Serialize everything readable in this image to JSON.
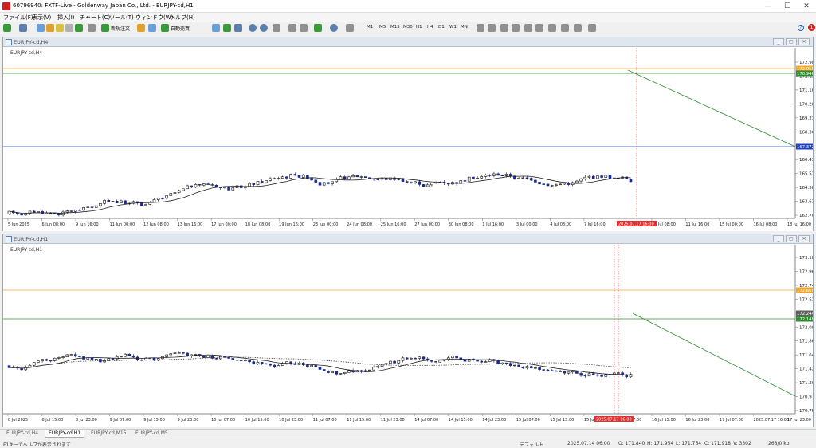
{
  "window": {
    "title": "60796940: FXTF-Live - Goldenway Japan Co., Ltd. - EURJPY-cd,H1",
    "minimize": "—",
    "maximize": "☐",
    "close": "✕"
  },
  "menu": [
    "ファイル(F)",
    "表示(V)",
    "挿入(I)",
    "チャート(C)",
    "ツール(T)",
    "ウィンドウ(W)",
    "ヘルプ(H)"
  ],
  "toolbar": {
    "new_order": "新規注文",
    "auto_trade": "自動売買",
    "timeframes": [
      "M1",
      "M5",
      "M15",
      "M30",
      "H1",
      "H4",
      "D1",
      "W1",
      "MN"
    ],
    "help": "?",
    "notification_count": "1"
  },
  "h4_chart": {
    "window_title": "EURJPY-cd,H4",
    "label": "EURJPY-cd,H4",
    "price_labels": [
      "172.980",
      "172.155",
      "171.105",
      "170.280",
      "169.230",
      "168.305",
      "167.480",
      "166.430",
      "165.530",
      "164.580",
      "163.630",
      "162.705"
    ],
    "tags": [
      {
        "text": "172.055",
        "color": "#f5a623"
      },
      {
        "text": "170.946",
        "color": "#2e8b2e"
      },
      {
        "text": "167.372",
        "color": "#2040c0"
      }
    ],
    "date_labels": [
      "5 Jun 2025",
      "6 Jun 08:00",
      "9 Jun 16:00",
      "11 Jun 00:00",
      "12 Jun 08:00",
      "13 Jun 16:00",
      "17 Jun 00:00",
      "18 Jun 08:00",
      "19 Jun 16:00",
      "23 Jun 00:00",
      "24 Jun 08:00",
      "25 Jun 16:00",
      "27 Jun 00:00",
      "30 Jun 08:00",
      "1 Jul 16:00",
      "3 Jul 00:00",
      "4 Jul 08:00",
      "7 Jul 16:00",
      "9 Jul 00:00",
      "10 Jul 08:00",
      "11 Jul 16:00",
      "15 Jul 00:00",
      "16 Jul 08:00",
      "18 Jul 16:00"
    ],
    "highlight_date": "2025.07.17 16:00",
    "chart_data": {
      "type": "candlestick",
      "ylim": [
        162.3,
        173.6
      ],
      "open": 162.6,
      "drift": [
        0.025,
        0.02,
        0.03,
        0.05,
        -0.03,
        0.03,
        0.035,
        0.01,
        -0.025,
        0.06,
        0.09,
        -0.02,
        0.01,
        0.015,
        0.005,
        -0.01,
        0.04,
        0.06,
        0.04,
        -0.04,
        0.02,
        0.06,
        0.035,
        -0.05
      ],
      "ma_color": "#222222"
    }
  },
  "h1_chart": {
    "window_title": "EURJPY-cd,H1",
    "label": "EURJPY-cd,H1",
    "price_labels": [
      "173.185",
      "172.965",
      "172.745",
      "172.525",
      "172.300",
      "172.080",
      "171.860",
      "171.640",
      "171.420",
      "171.200",
      "170.975",
      "170.755"
    ],
    "tags": [
      {
        "text": "172.605",
        "color": "#f5a623"
      },
      {
        "text": "172.244",
        "color": "#606060"
      },
      {
        "text": "172.148",
        "color": "#2e8b2e"
      }
    ],
    "date_labels": [
      "8 Jul 2025",
      "8 Jul 15:00",
      "8 Jul 23:00",
      "9 Jul 07:00",
      "9 Jul 15:00",
      "9 Jul 23:00",
      "10 Jul 07:00",
      "10 Jul 15:00",
      "10 Jul 23:00",
      "11 Jul 07:00",
      "11 Jul 15:00",
      "11 Jul 23:00",
      "14 Jul 07:00",
      "14 Jul 15:00",
      "14 Jul 23:00",
      "15 Jul 07:00",
      "15 Jul 15:00",
      "15 Jul 23:00",
      "16 Jul 07:00",
      "16 Jul 15:00",
      "16 Jul 23:00",
      "17 Jul 07:00",
      "2025.07.17 16:00",
      "17 Jul 23:00"
    ],
    "highlight_date": "2025.07.17 16:00",
    "chart_data": {
      "type": "candlestick",
      "ylim": [
        170.7,
        173.35
      ],
      "open": 171.5,
      "drift": [
        0.02,
        0.02,
        -0.02,
        -0.02,
        -0.015,
        0.015,
        -0.02,
        -0.01,
        0.03,
        0.03,
        -0.015,
        0.01,
        0.015,
        0.01,
        0.01,
        0.025,
        0.02,
        -0.005,
        -0.035,
        0.02,
        0.01,
        -0.005,
        -0.005,
        0.0
      ],
      "ma_color": "#222222",
      "ma2_color": "#444444"
    }
  },
  "tabs": [
    "EURJPY-cd,H4",
    "EURJPY-cd,H1",
    "EURJPY-cd,M15",
    "EURJPY-cd,M5"
  ],
  "status": {
    "help": "F1キーでヘルプが表示されます",
    "profile": "デフォルト",
    "datetime": "2025.07.14 06:00",
    "open": "O: 171.840",
    "high": "H: 171.954",
    "low": "L: 171.764",
    "close": "C: 171.918",
    "volume": "V: 3302",
    "traffic": "268/0 kb"
  }
}
